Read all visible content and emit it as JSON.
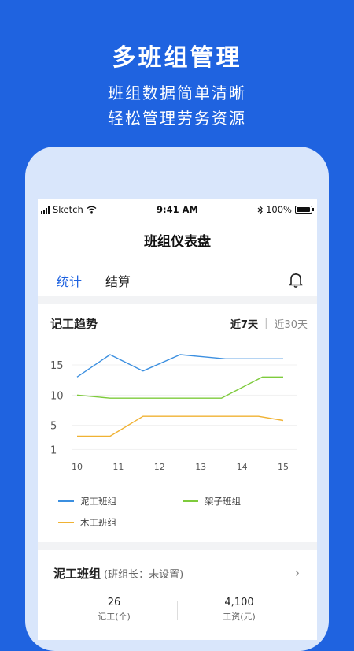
{
  "hero": {
    "title": "多班组管理",
    "subtitle1": "班组数据简单清晰",
    "subtitle2": "轻松管理劳务资源"
  },
  "statusbar": {
    "carrier": "Sketch",
    "time": "9:41 AM",
    "battery": "100%"
  },
  "page_title": "班组仪表盘",
  "tabs": [
    {
      "label": "统计",
      "active": true
    },
    {
      "label": "结算",
      "active": false
    }
  ],
  "trend_card": {
    "title": "记工趋势",
    "range_options": [
      "近7天",
      "近30天"
    ],
    "selected_range": "近7天"
  },
  "chart_data": {
    "type": "line",
    "title": "记工趋势",
    "x": [
      10,
      11,
      12,
      13,
      14,
      15
    ],
    "y_ticks": [
      15,
      10,
      5,
      1
    ],
    "ylim": [
      0,
      18
    ],
    "grid": true,
    "legend_placement": "bottom",
    "series": [
      {
        "name": "泥工班组",
        "color": "#3b8fe0",
        "points": [
          [
            10,
            13
          ],
          [
            10.8,
            16.7
          ],
          [
            11.6,
            14
          ],
          [
            12.5,
            16.7
          ],
          [
            13.6,
            16
          ],
          [
            15,
            16
          ]
        ]
      },
      {
        "name": "架子班组",
        "color": "#7ecb3c",
        "points": [
          [
            10,
            10
          ],
          [
            10.8,
            9.5
          ],
          [
            13.5,
            9.5
          ],
          [
            14.5,
            13
          ],
          [
            15,
            13
          ]
        ]
      },
      {
        "name": "木工班组",
        "color": "#f0b233",
        "points": [
          [
            10,
            3.2
          ],
          [
            10.8,
            3.2
          ],
          [
            11.6,
            6.5
          ],
          [
            14.4,
            6.5
          ],
          [
            15,
            5.8
          ]
        ]
      }
    ]
  },
  "team_card": {
    "name": "泥工班组",
    "leader": "(班组长：未设置)",
    "stats": [
      {
        "value": "26",
        "label": "记工(个)"
      },
      {
        "value": "4,100",
        "label": "工资(元)"
      }
    ]
  },
  "colors": {
    "brand_blue": "#1f63e0",
    "phone_frame": "#d9e6fb"
  }
}
